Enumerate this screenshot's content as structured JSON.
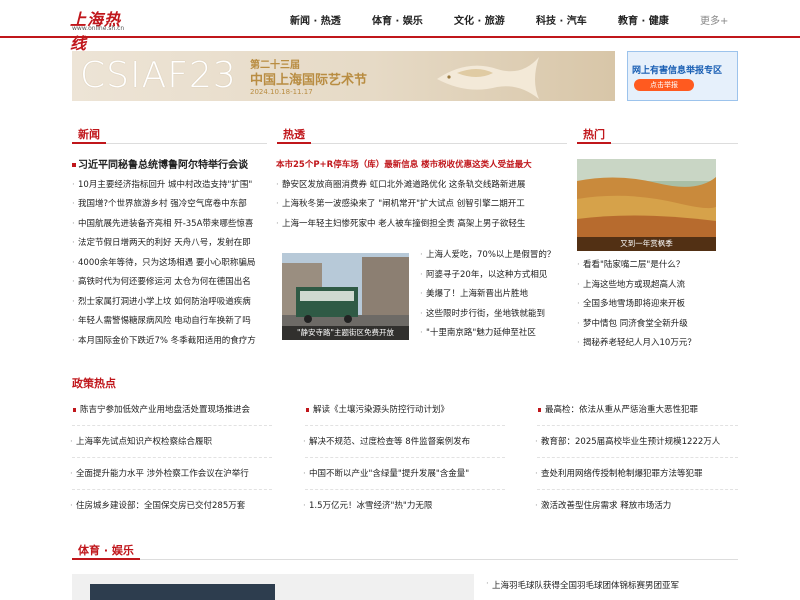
{
  "header": {
    "logo_text": "上海热线",
    "logo_url_text": "www.online.sh.cn",
    "nav": [
      {
        "label": "新闻 · 热透"
      },
      {
        "label": "体育 · 娱乐"
      },
      {
        "label": "文化 · 旅游"
      },
      {
        "label": "科技 · 汽车"
      },
      {
        "label": "教育 · 健康"
      },
      {
        "label": "更多+"
      }
    ]
  },
  "banner": {
    "code": "CSIAF23",
    "edition": "第二十三届",
    "title": "中国上海国际艺术节",
    "date": "2024.10.18-11.17"
  },
  "side_ad": {
    "title": "网上有害信息举报专区",
    "button": "点击举报"
  },
  "news": {
    "heading": "新闻",
    "items": [
      "习近平同秘鲁总统博鲁阿尔特举行会谈",
      "10月主要经济指标回升 城中村改造支持\"扩围\"",
      "我国增?个世界旅游乡村 强冷空气席卷中东部",
      "中国航展先进装备齐亮相 歼-35A带来哪些惊喜",
      "法定节假日增两天的利好 天舟八号，发射在即",
      "4000余年等待，只为这场相遇 要小心职称骗局",
      "高铁时代为何还要修运河 太仓为何在德国出名",
      "烈士家属打洞进小学上坟 如何防治呼吸道疾病",
      "年轻人需警惕糖尿病风险 电动自行车换新了吗",
      "本月国际金价下跌近7% 冬季截阳适用的食疗方"
    ]
  },
  "hot": {
    "heading": "热透",
    "top": "本市25个P+R停车场（库）最新信息 楼市税收优惠这类人受益最大",
    "items": [
      "静安区发放商圈消费券 虹口北外滩道路优化 这条轨交线路新进展",
      "上海秋冬第一波感染来了 \"闸机常开\"扩大试点 创智引擎二期开工",
      "上海一年轻主妇惨死家中 老人被车撞倒担全责 高架上男子欲轻生"
    ],
    "photo_caption": "\"静安寺路\"主题街区免费开放",
    "side_items": [
      "上海人爱吃，70%以上是假冒的？",
      "阿婆寻子20年，以这种方式相见",
      "美爆了！上海新晋出片胜地",
      "这些限时步行街，坐地铁就能到",
      "\"十里南京路\"魅力延伸至社区"
    ]
  },
  "popular": {
    "heading": "热门",
    "photo_caption": "又到一年赏枫季",
    "items": [
      "看看\"陆家嘴二层\"是什么？",
      "上海这些地方或现超高人流",
      "全国多地雪场即将迎来开板",
      "梦中情包 同济食堂全新升级",
      "揭秘养老轻纪人月入10万元？"
    ]
  },
  "policy": {
    "heading": "政策热点",
    "col1": [
      "陈吉宁参加低效产业用地盘活处置现场推进会",
      "上海率先试点知识产权检察综合履职",
      "全面提升能力水平 涉外检察工作会议在沪举行",
      "住房城乡建设部：全国保交房已交付285万套"
    ],
    "col2": [
      "解读《土壤污染源头防控行动计划》",
      "解决不规范、过度检查等 8件监督案例发布",
      "中国不断以产业\"含绿量\"提升发展\"含金量\"",
      "1.5万亿元！冰雪经济\"热\"力无限"
    ],
    "col3": [
      "最高检：依法从重从严惩治重大恶性犯罪",
      "教育部：2025届高校毕业生预计规模1222万人",
      "查处利用网络传授制枪制爆犯罪方法等犯罪",
      "激活改善型住房需求 释放市场活力"
    ]
  },
  "sports": {
    "heading": "体育 · 娱乐",
    "item": "上海羽毛球队获得全国羽毛球团体锦标赛男团亚军"
  },
  "colors": {
    "accent": "#c0161b",
    "banner_gold": "#b98d42",
    "ad_blue": "#1a5fb4"
  }
}
